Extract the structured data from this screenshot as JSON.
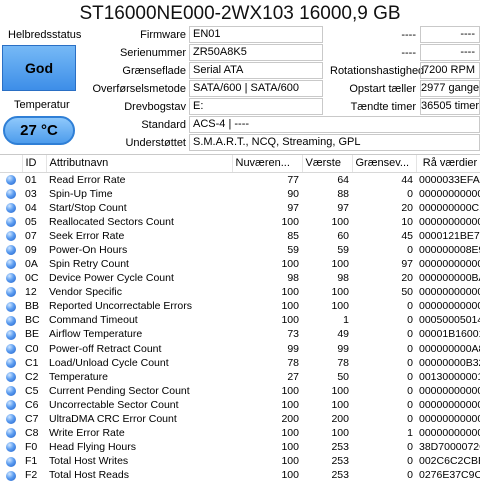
{
  "title": "ST16000NE000-2WX103 16000,9 GB",
  "health": {
    "label": "Helbredsstatus",
    "value": "God"
  },
  "temperature": {
    "label": "Temperatur",
    "value": "27 °C"
  },
  "info": [
    {
      "label": "Firmware",
      "value": "EN01"
    },
    {
      "label": "Serienummer",
      "value": "ZR50A8K5"
    },
    {
      "label": "Grænseflade",
      "value": "Serial ATA"
    },
    {
      "label": "Overførselsmetode",
      "value": "SATA/600 | SATA/600"
    },
    {
      "label": "Drevbogstav",
      "value": "E:"
    },
    {
      "label": "Standard",
      "value": "ACS-4 | ----"
    },
    {
      "label": "Understøttet",
      "value": "S.M.A.R.T., NCQ, Streaming, GPL"
    }
  ],
  "right_info": [
    {
      "label": "----",
      "value": "----"
    },
    {
      "label": "----",
      "value": "----"
    },
    {
      "label": "Rotationshastighed",
      "value": "7200 RPM"
    },
    {
      "label": "Opstart tæller",
      "value": "2977 gange"
    },
    {
      "label": "Tændte timer",
      "value": "36505 timer"
    }
  ],
  "table": {
    "headers": [
      "ID",
      "Attributnavn",
      "Nuværen...",
      "Værste",
      "Grænsev...",
      "Rå værdier"
    ],
    "rows": [
      [
        "01",
        "Read Error Rate",
        "77",
        "64",
        "44",
        "0000033EFAD4"
      ],
      [
        "03",
        "Spin-Up Time",
        "90",
        "88",
        "0",
        "000000000000"
      ],
      [
        "04",
        "Start/Stop Count",
        "97",
        "97",
        "20",
        "000000000C10"
      ],
      [
        "05",
        "Reallocated Sectors Count",
        "100",
        "100",
        "10",
        "000000000000"
      ],
      [
        "07",
        "Seek Error Rate",
        "85",
        "60",
        "45",
        "0000121BE726"
      ],
      [
        "09",
        "Power-On Hours",
        "59",
        "59",
        "0",
        "000000008E99"
      ],
      [
        "0A",
        "Spin Retry Count",
        "100",
        "100",
        "97",
        "000000000000"
      ],
      [
        "0C",
        "Device Power Cycle Count",
        "98",
        "98",
        "20",
        "000000000BA1"
      ],
      [
        "12",
        "Vendor Specific",
        "100",
        "100",
        "50",
        "000000000000"
      ],
      [
        "BB",
        "Reported Uncorrectable Errors",
        "100",
        "100",
        "0",
        "000000000000"
      ],
      [
        "BC",
        "Command Timeout",
        "100",
        "1",
        "0",
        "000500050146"
      ],
      [
        "BE",
        "Airflow Temperature",
        "73",
        "49",
        "0",
        "00001B16001B"
      ],
      [
        "C0",
        "Power-off Retract Count",
        "99",
        "99",
        "0",
        "000000000A83"
      ],
      [
        "C1",
        "Load/Unload Cycle Count",
        "78",
        "78",
        "0",
        "00000000B32F"
      ],
      [
        "C2",
        "Temperature",
        "27",
        "50",
        "0",
        "00130000001B"
      ],
      [
        "C5",
        "Current Pending Sector Count",
        "100",
        "100",
        "0",
        "000000000000"
      ],
      [
        "C6",
        "Uncorrectable Sector Count",
        "100",
        "100",
        "0",
        "000000000000"
      ],
      [
        "C7",
        "UltraDMA CRC Error Count",
        "200",
        "200",
        "0",
        "000000000000"
      ],
      [
        "C8",
        "Write Error Rate",
        "100",
        "100",
        "1",
        "000000000000"
      ],
      [
        "F0",
        "Head Flying Hours",
        "100",
        "253",
        "0",
        "38D7000072CE"
      ],
      [
        "F1",
        "Total Host Writes",
        "100",
        "253",
        "0",
        "002C6C2CBE60"
      ],
      [
        "F2",
        "Total Host Reads",
        "100",
        "253",
        "0",
        "0276E37C9C4C"
      ]
    ]
  },
  "colors": {
    "health_bg": "#4a9af0",
    "status_dot": "#3b82e6"
  },
  "icons": {
    "status_dot": "blue-circle-icon"
  }
}
